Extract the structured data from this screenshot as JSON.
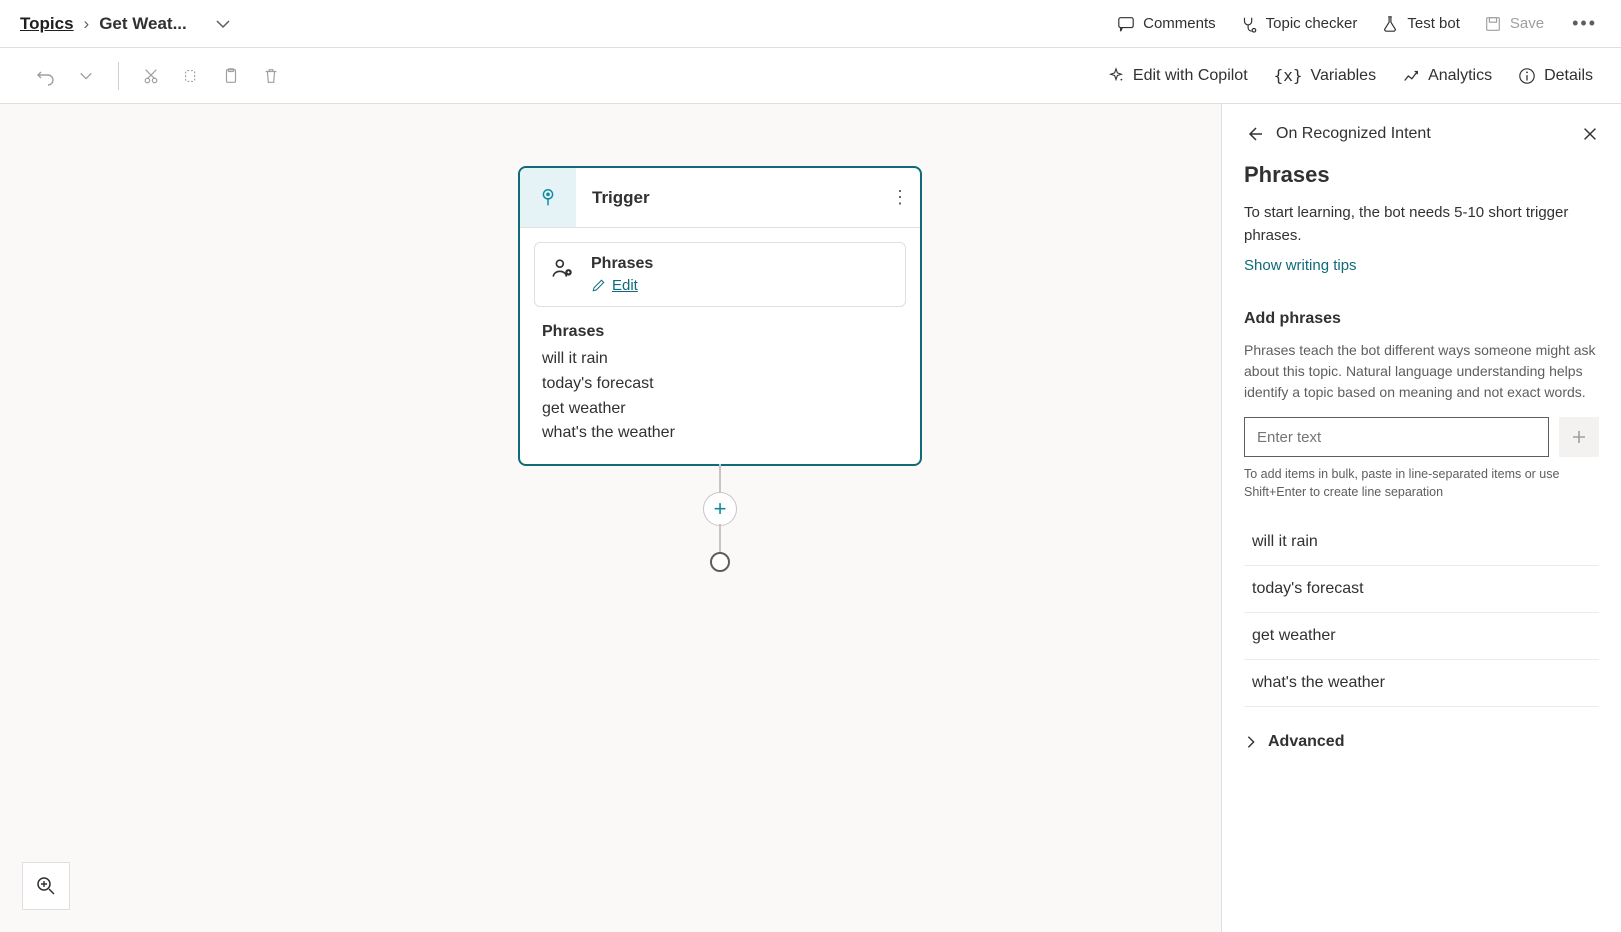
{
  "breadcrumb": {
    "root": "Topics",
    "current": "Get Weat..."
  },
  "header": {
    "comments": "Comments",
    "topic_checker": "Topic checker",
    "test_bot": "Test bot",
    "save": "Save"
  },
  "toolbar": {
    "edit_copilot": "Edit with Copilot",
    "variables": "Variables",
    "analytics": "Analytics",
    "details": "Details"
  },
  "node": {
    "title": "Trigger",
    "phrases_label": "Phrases",
    "edit": "Edit",
    "list_title": "Phrases",
    "phrases": [
      "will it rain",
      "today's forecast",
      "get weather",
      "what's the weather"
    ]
  },
  "panel": {
    "title_crumb": "On Recognized Intent",
    "heading": "Phrases",
    "intro": "To start learning, the bot needs 5-10 short trigger phrases.",
    "tips_link": "Show writing tips",
    "add_heading": "Add phrases",
    "add_hint": "Phrases teach the bot different ways someone might ask about this topic. Natural language understanding helps identify a topic based on meaning and not exact words.",
    "input_placeholder": "Enter text",
    "bulk_hint": "To add items in bulk, paste in line-separated items or use Shift+Enter to create line separation",
    "phrases": [
      "will it rain",
      "today's forecast",
      "get weather",
      "what's the weather"
    ],
    "advanced": "Advanced"
  }
}
